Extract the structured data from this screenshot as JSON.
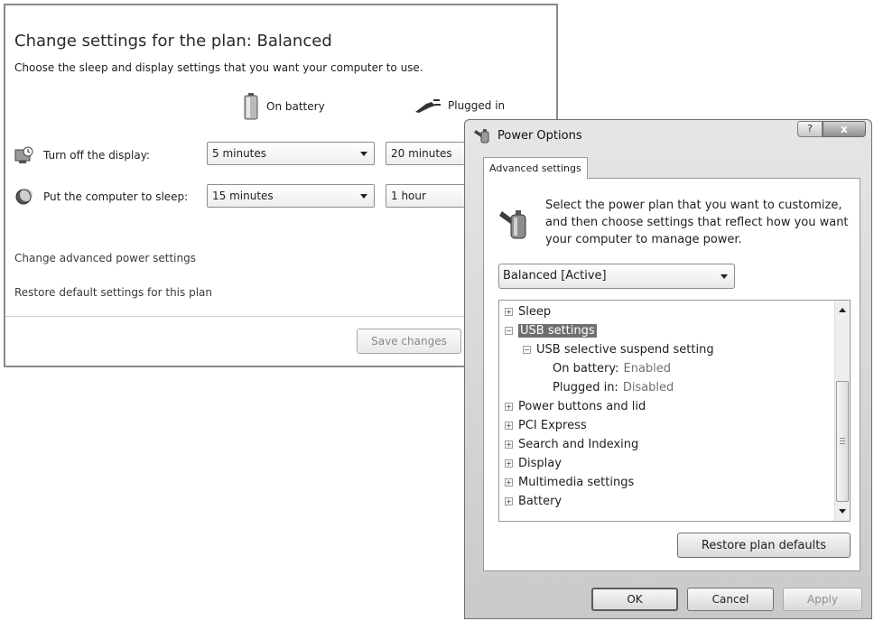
{
  "plan_window": {
    "title": "Change settings for the plan: Balanced",
    "subtitle": "Choose the sleep and display settings that you want your computer to use.",
    "columns": {
      "battery": "On battery",
      "plugged": "Plugged in"
    },
    "rows": {
      "display": {
        "label": "Turn off the display:",
        "battery_value": "5 minutes",
        "plugged_value": "20 minutes"
      },
      "sleep": {
        "label": "Put the computer to sleep:",
        "battery_value": "15 minutes",
        "plugged_value": "1 hour"
      }
    },
    "links": {
      "advanced": "Change advanced power settings",
      "restore": "Restore default settings for this plan"
    },
    "save_label": "Save changes"
  },
  "dialog": {
    "title": "Power Options",
    "help_label": "?",
    "close_label": "x",
    "tab_label": "Advanced settings",
    "description": "Select the power plan that you want to customize, and then choose settings that reflect how you want your computer to manage power.",
    "plan_select": "Balanced [Active]",
    "tree": {
      "sleep": "Sleep",
      "usb": "USB settings",
      "usb_suspend": "USB selective suspend setting",
      "on_battery_label": "On battery:",
      "on_battery_value": "Enabled",
      "plugged_label": "Plugged in:",
      "plugged_value": "Disabled",
      "power_buttons": "Power buttons and lid",
      "pci": "PCI Express",
      "search": "Search and Indexing",
      "display": "Display",
      "multimedia": "Multimedia settings",
      "battery": "Battery"
    },
    "restore_label": "Restore plan defaults",
    "ok_label": "OK",
    "cancel_label": "Cancel",
    "apply_label": "Apply"
  }
}
